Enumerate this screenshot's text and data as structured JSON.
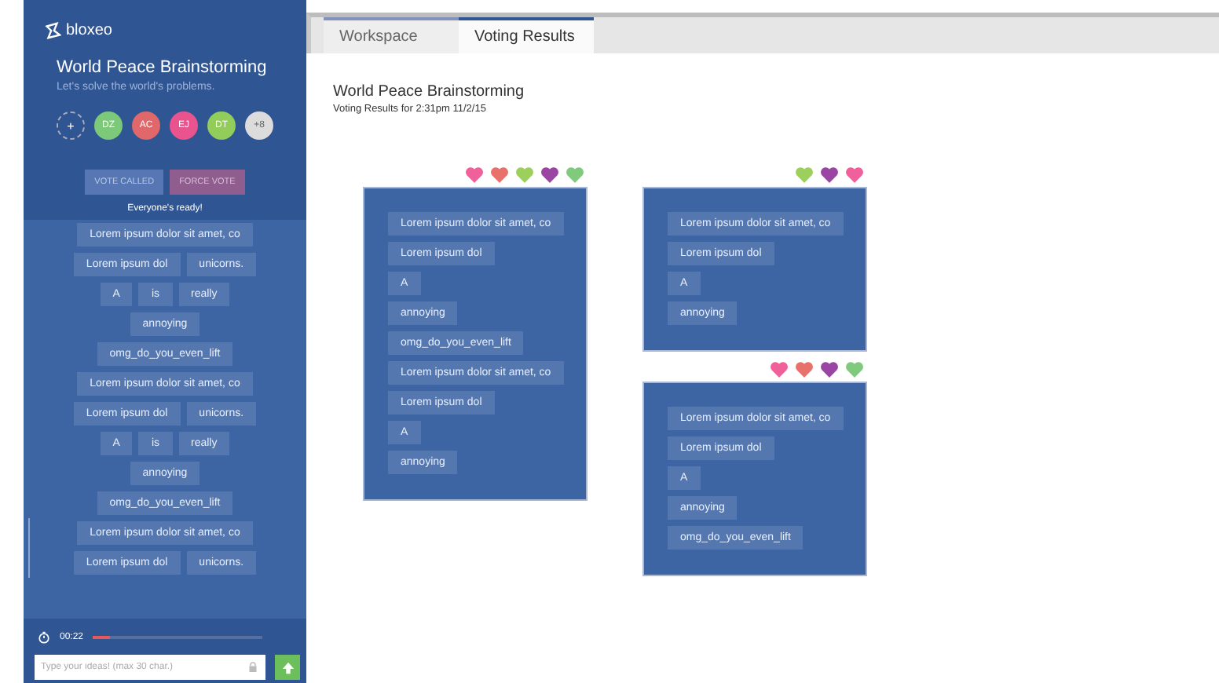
{
  "sidebar": {
    "logo": "bloxeo",
    "title": "World Peace Brainstorming",
    "subtitle": "Let's solve the world's problems.",
    "avatars": [
      {
        "kind": "add",
        "label": "+"
      },
      {
        "kind": "user",
        "label": "DZ",
        "color": "#7cc97a"
      },
      {
        "kind": "user",
        "label": "AC",
        "color": "#e0676a"
      },
      {
        "kind": "user",
        "label": "EJ",
        "color": "#e9548e"
      },
      {
        "kind": "user",
        "label": "DT",
        "color": "#92cc5a"
      },
      {
        "kind": "more",
        "label": "+8"
      }
    ],
    "buttons": [
      {
        "kind": "called",
        "label": "VOTE CALLED"
      },
      {
        "kind": "force",
        "label": "FORCE VOTE"
      }
    ],
    "status": "Everyone's ready!",
    "idea_rows": [
      [
        "Lorem ipsum dolor sit amet, co"
      ],
      [
        "Lorem ipsum dol",
        "unicorns."
      ],
      [
        "A",
        "is",
        "really"
      ],
      [
        "annoying"
      ],
      [
        "omg_do_you_even_lift"
      ],
      [
        "Lorem ipsum dolor sit amet, co"
      ],
      [
        "Lorem ipsum dol",
        "unicorns."
      ],
      [
        "A",
        "is",
        "really"
      ],
      [
        "annoying"
      ],
      [
        "omg_do_you_even_lift"
      ],
      [
        "Lorem ipsum dolor sit amet, co"
      ],
      [
        "Lorem ipsum dol",
        "unicorns."
      ]
    ],
    "timer": {
      "time": "00:22",
      "level": 0.1
    },
    "input": {
      "placeholder": "Type your ideas! (max 30 char.)"
    }
  },
  "tabs": [
    {
      "label": "Workspace",
      "selected": false
    },
    {
      "label": "Voting Results",
      "selected": true
    }
  ],
  "results": {
    "title": "World Peace Brainstorming",
    "subtitle": "Voting Results for 2:31pm 11/2/15",
    "columns": [
      [
        {
          "votes": [
            {
              "color": "#f0609a"
            },
            {
              "color": "#e8716c"
            },
            {
              "color": "#9ccf5c"
            },
            {
              "color": "#9a45a3"
            },
            {
              "color": "#7fca7d"
            }
          ],
          "ideas": [
            "Lorem ipsum dolor sit amet, co",
            "Lorem ipsum dol",
            "A",
            "annoying",
            "omg_do_you_even_lift",
            "Lorem ipsum dolor sit amet, co",
            "Lorem ipsum dol",
            "A",
            "annoying"
          ]
        }
      ],
      [
        {
          "votes": [
            {
              "color": "#9ccf5c"
            },
            {
              "color": "#9a45a3"
            },
            {
              "color": "#f0609a"
            }
          ],
          "ideas": [
            "Lorem ipsum dolor sit amet, co",
            "Lorem ipsum dol",
            "A",
            "annoying"
          ]
        },
        {
          "votes": [
            {
              "color": "#f0609a"
            },
            {
              "color": "#e8716c"
            },
            {
              "color": "#9a45a3"
            },
            {
              "color": "#7fca7d"
            }
          ],
          "ideas": [
            "Lorem ipsum dolor sit amet, co",
            "Lorem ipsum dol",
            "A",
            "annoying",
            "omg_do_you_even_lift"
          ]
        }
      ]
    ]
  }
}
